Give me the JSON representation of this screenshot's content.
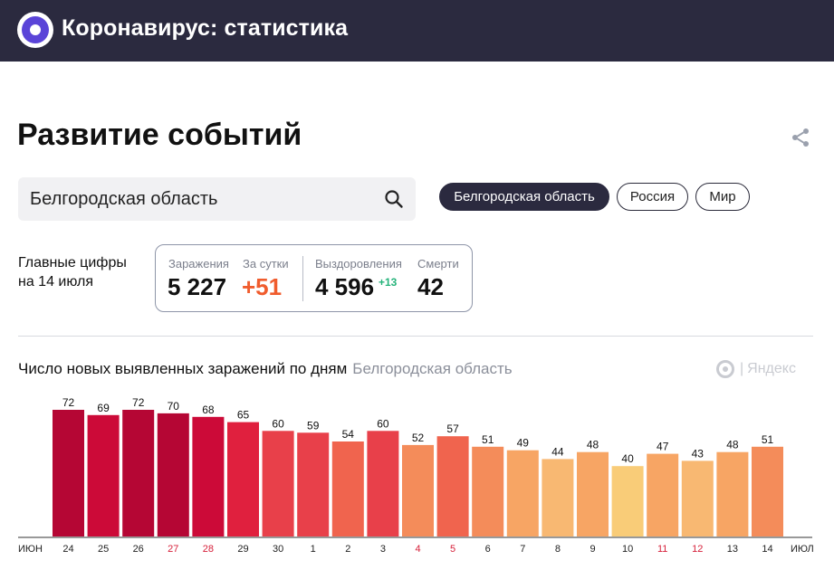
{
  "header": {
    "title": "Коронавирус: статистика",
    "logo_icon": "virus-logo-icon"
  },
  "page": {
    "title": "Развитие событий",
    "share_icon": "share-icon"
  },
  "search": {
    "value": "Белгородская область",
    "icon": "search-icon"
  },
  "chips": [
    {
      "label": "Белгородская область",
      "active": true
    },
    {
      "label": "Россия",
      "active": false
    },
    {
      "label": "Мир",
      "active": false
    }
  ],
  "summary": {
    "label_line1": "Главные цифры",
    "label_line2": "на 14 июля",
    "infections_label": "Заражения",
    "infections_value": "5 227",
    "daily_label": "За сутки",
    "daily_value": "+51",
    "recoveries_label": "Выздоровления",
    "recoveries_value": "4 596",
    "recoveries_delta": "+13",
    "deaths_label": "Смерти",
    "deaths_value": "42"
  },
  "chart_header": {
    "title": "Число новых выявленных заражений по дням",
    "region": "Белгородская область",
    "watermark": "Яндекс"
  },
  "chart_data": {
    "type": "bar",
    "title": "Число новых выявленных заражений по дням",
    "categories": [
      "24",
      "25",
      "26",
      "27",
      "28",
      "29",
      "30",
      "1",
      "2",
      "3",
      "4",
      "5",
      "6",
      "7",
      "8",
      "9",
      "10",
      "11",
      "12",
      "13",
      "14"
    ],
    "values": [
      72,
      69,
      72,
      70,
      68,
      65,
      60,
      59,
      54,
      60,
      52,
      57,
      51,
      49,
      44,
      48,
      40,
      47,
      43,
      48,
      51
    ],
    "weekend": [
      false,
      false,
      false,
      true,
      true,
      false,
      false,
      false,
      false,
      false,
      true,
      true,
      false,
      false,
      false,
      false,
      false,
      true,
      true,
      false,
      false
    ],
    "month_start_label": "ИЮН",
    "month_end_label": "ИЮЛ",
    "ylim": [
      0,
      72
    ],
    "grid": false,
    "colors": {
      "bars_by_level": [
        "#f9e08a",
        "#f9cc78",
        "#f8b872",
        "#f7a564",
        "#f48c5a",
        "#f0644e",
        "#e8404a",
        "#e0203e",
        "#cc0a38",
        "#b50634"
      ],
      "weekend_label": "#d6203a",
      "weekday_label": "#222222"
    }
  }
}
